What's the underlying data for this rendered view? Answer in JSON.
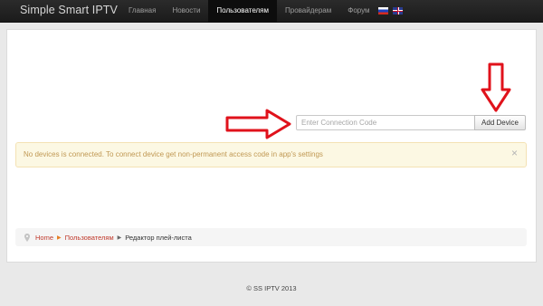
{
  "navbar": {
    "brand": "Simple Smart IPTV",
    "items": [
      {
        "label": "Главная",
        "active": false
      },
      {
        "label": "Новости",
        "active": false
      },
      {
        "label": "Пользователям",
        "active": true
      },
      {
        "label": "Провайдерам",
        "active": false
      },
      {
        "label": "Форум",
        "active": false
      }
    ],
    "flags": [
      "russian-flag-icon",
      "english-flag-icon"
    ]
  },
  "device_form": {
    "placeholder": "Enter Connection Code",
    "value": "",
    "button_label": "Add Device"
  },
  "alert": {
    "text": "No devices is connected. To connect device get non-permanent access code in app's settings",
    "close": "×"
  },
  "breadcrumb": {
    "items": [
      "Home",
      "Пользователям"
    ],
    "current": "Редактор плей-листа"
  },
  "footer": {
    "text": "© SS IPTV 2013"
  },
  "colors": {
    "navbar_bg": "#1b1b1b",
    "alert_bg": "#fcf8e3",
    "alert_text": "#c09853",
    "link": "#c0392b",
    "arrow": "#e0121b"
  },
  "annotations": [
    "red-arrow-right-icon",
    "red-arrow-down-icon"
  ]
}
